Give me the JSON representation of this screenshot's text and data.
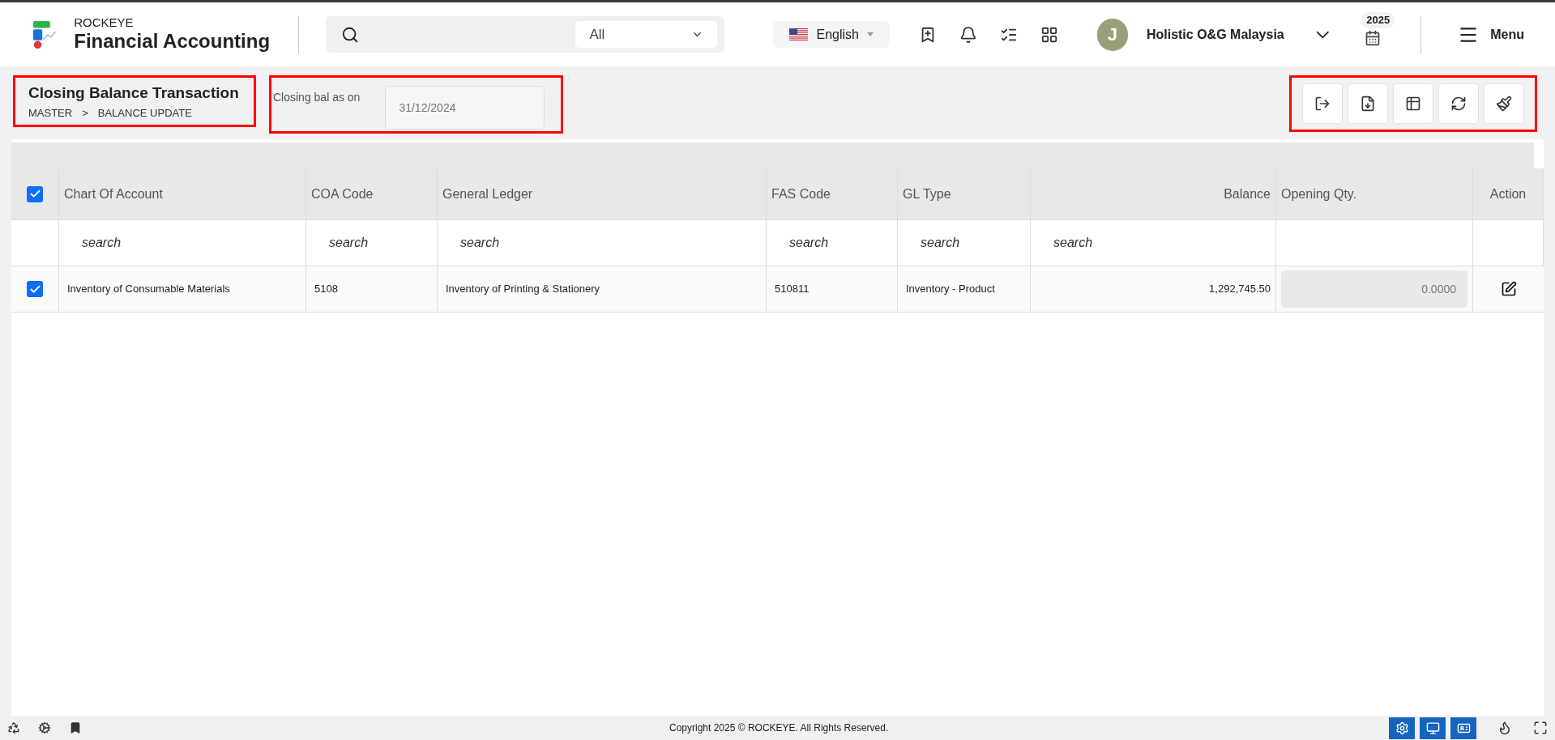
{
  "header": {
    "brand_top": "ROCKEYE",
    "brand_name": "Financial Accounting",
    "search_filter": "All",
    "language": "English",
    "user_initial": "J",
    "company": "Holistic O&G Malaysia",
    "year": "2025",
    "menu": "Menu"
  },
  "page": {
    "title": "Closing Balance Transaction",
    "breadcrumb": [
      "MASTER",
      ">",
      "BALANCE UPDATE"
    ],
    "date_label": "Closing bal as on",
    "date_value": "31/12/2024"
  },
  "table": {
    "all_checked": true,
    "columns": [
      {
        "label": "Chart Of Account",
        "kind": "text",
        "placeholder": "search"
      },
      {
        "label": "COA Code",
        "kind": "text",
        "placeholder": "search"
      },
      {
        "label": "General Ledger",
        "kind": "text",
        "placeholder": "search"
      },
      {
        "label": "FAS Code",
        "kind": "text",
        "placeholder": "search"
      },
      {
        "label": "GL Type",
        "kind": "text",
        "placeholder": "search"
      },
      {
        "label": "Balance",
        "kind": "amount",
        "placeholder": "search"
      },
      {
        "label": "Opening Qty.",
        "kind": "input"
      },
      {
        "label": "Action",
        "kind": "action"
      }
    ],
    "rows": [
      {
        "checked": true,
        "cells": [
          "Inventory of Consumable Materials",
          "5108",
          "Inventory of Printing & Stationery",
          "510811",
          "Inventory - Product",
          "1,292,745.50"
        ],
        "opening_qty": "0.0000"
      }
    ]
  },
  "footer": {
    "copyright": "Copyright 2025 © ROCKEYE. All Rights Reserved."
  }
}
